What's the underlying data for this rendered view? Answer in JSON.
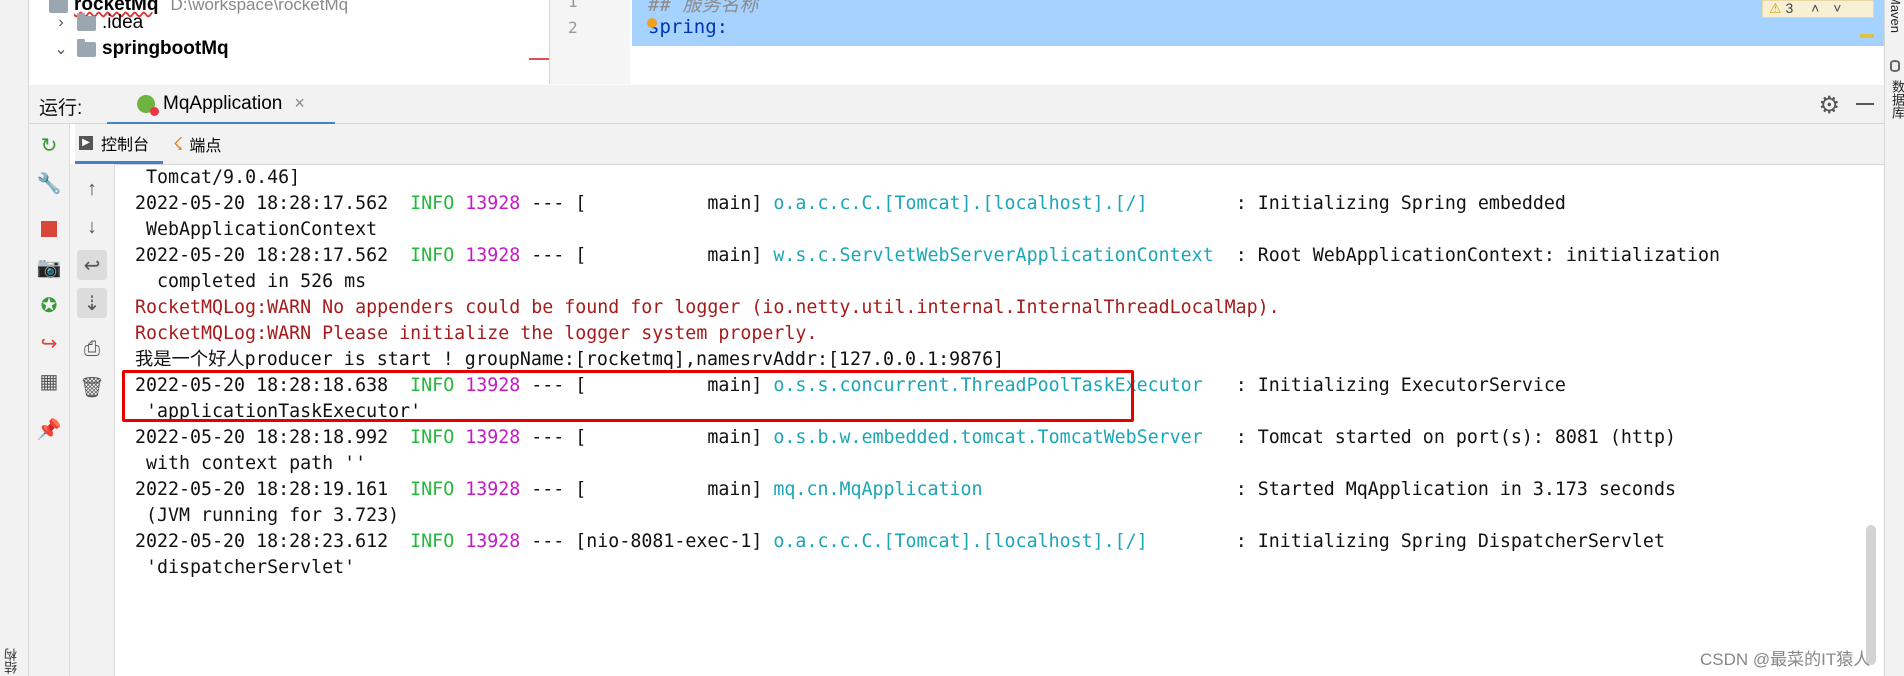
{
  "project_tree": {
    "root_label": "rocketMq",
    "root_path": "D:\\workspace\\rocketMq",
    "items": [
      {
        "label": ".idea",
        "expanded": false
      },
      {
        "label": "springbootMq",
        "expanded": true
      }
    ]
  },
  "editor": {
    "lines": [
      {
        "no": "1",
        "text": "## 服务名称"
      },
      {
        "no": "2",
        "text": "spring:"
      }
    ],
    "warning_count": "3"
  },
  "run_panel": {
    "label": "运行:",
    "tab_label": "MqApplication",
    "subtabs": [
      "控制台",
      "端点"
    ]
  },
  "console": {
    "lines": [
      {
        "indent": " ",
        "plain": "Tomcat/9.0.46]"
      },
      {
        "ts": "2022-05-20 18:28:17.562",
        "level": "INFO",
        "pid": "13928",
        "sep": "--- [",
        "thread": "           main]",
        "logger": "o.a.c.c.C.[Tomcat].[localhost].[/]       ",
        "msg": ": Initializing Spring embedded"
      },
      {
        "indent": " ",
        "plain": "WebApplicationContext"
      },
      {
        "ts": "2022-05-20 18:28:17.562",
        "level": "INFO",
        "pid": "13928",
        "sep": "--- [",
        "thread": "           main]",
        "logger": "w.s.c.ServletWebServerApplicationContext ",
        "msg": ": Root WebApplicationContext: initialization"
      },
      {
        "indent": "  ",
        "plain": "completed in 526 ms"
      },
      {
        "err": "RocketMQLog:WARN No appenders could be found for logger (io.netty.util.internal.InternalThreadLocalMap)."
      },
      {
        "err": "RocketMQLog:WARN Please initialize the logger system properly."
      },
      {
        "plain": "我是一个好人producer is start ! groupName:[rocketmq],namesrvAddr:[127.0.0.1:9876]"
      },
      {
        "ts": "2022-05-20 18:28:18.638",
        "level": "INFO",
        "pid": "13928",
        "sep": "--- [",
        "thread": "           main]",
        "logger": "o.s.s.concurrent.ThreadPoolTaskExecutor  ",
        "msg": ": Initializing ExecutorService"
      },
      {
        "indent": " ",
        "plain": "'applicationTaskExecutor'"
      },
      {
        "ts": "2022-05-20 18:28:18.992",
        "level": "INFO",
        "pid": "13928",
        "sep": "--- [",
        "thread": "           main]",
        "logger": "o.s.b.w.embedded.tomcat.TomcatWebServer  ",
        "msg": ": Tomcat started on port(s): 8081 (http)"
      },
      {
        "indent": " ",
        "plain": "with context path ''"
      },
      {
        "ts": "2022-05-20 18:28:19.161",
        "level": "INFO",
        "pid": "13928",
        "sep": "--- [",
        "thread": "           main]",
        "logger": "mq.cn.MqApplication                      ",
        "msg": ": Started MqApplication in 3.173 seconds"
      },
      {
        "indent": " ",
        "plain": "(JVM running for 3.723)"
      },
      {
        "ts": "2022-05-20 18:28:23.612",
        "level": "INFO",
        "pid": "13928",
        "sep": "--- [",
        "thread": "nio-8081-exec-1]",
        "logger": "o.a.c.c.C.[Tomcat].[localhost].[/]       ",
        "msg": ": Initializing Spring DispatcherServlet"
      },
      {
        "indent": " ",
        "plain": "'dispatcherServlet'"
      }
    ]
  },
  "right_strip": {
    "labels": [
      "Maven",
      "数据库"
    ]
  },
  "left_strip": {
    "label": "结构"
  },
  "watermark": "CSDN @最菜的IT猿人",
  "colors": {
    "info": "#25b83b",
    "pid": "#c21ac5",
    "logger": "#1aa6b7",
    "warn": "#a61b1b",
    "highlight": "#e60000",
    "selection": "#a6d2ff"
  }
}
